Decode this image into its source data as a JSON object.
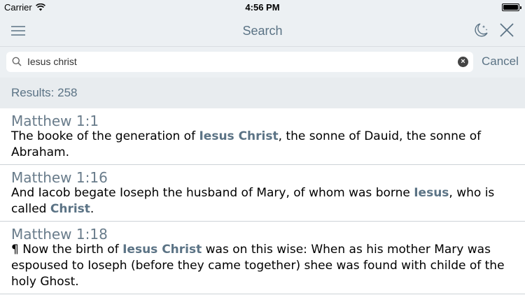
{
  "status_bar": {
    "carrier": "Carrier",
    "time": "4:56 PM"
  },
  "nav": {
    "title": "Search",
    "menu_icon": "hamburger-menu-icon",
    "night_icon": "moon-stars-icon",
    "close_icon": "close-icon"
  },
  "search": {
    "query": "Iesus christ",
    "cancel_label": "Cancel",
    "clear_icon": "clear-icon"
  },
  "results": {
    "count_label": "Results: 258",
    "items": [
      {
        "reference": "Matthew 1:1",
        "segments": [
          {
            "text": "The booke of the generation of ",
            "hl": false
          },
          {
            "text": "Iesus Christ",
            "hl": true
          },
          {
            "text": ", the sonne of Dauid, the sonne of Abraham.",
            "hl": false
          }
        ]
      },
      {
        "reference": "Matthew 1:16",
        "segments": [
          {
            "text": "And Iacob begate Ioseph the husband of Mary, of whom was borne ",
            "hl": false
          },
          {
            "text": "Iesus",
            "hl": true
          },
          {
            "text": ", who is called ",
            "hl": false
          },
          {
            "text": "Christ",
            "hl": true
          },
          {
            "text": ".",
            "hl": false
          }
        ]
      },
      {
        "reference": "Matthew 1:18",
        "segments": [
          {
            "text": "¶ Now the birth of ",
            "hl": false
          },
          {
            "text": "Iesus Christ",
            "hl": true
          },
          {
            "text": " was on this wise: When as his mother Mary was espoused to Ioseph (before they came together) shee was found with childe of the holy Ghost.",
            "hl": false
          }
        ]
      }
    ]
  },
  "colors": {
    "accent": "#5b7385",
    "bar_background": "#ecf0f3",
    "reference": "#697c8b"
  }
}
